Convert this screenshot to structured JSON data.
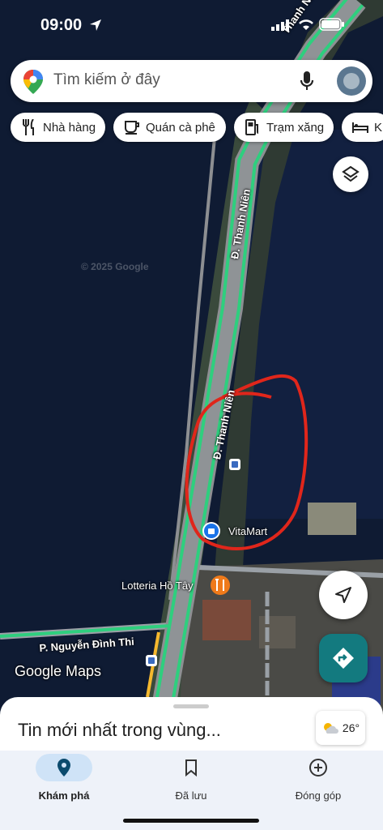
{
  "status_bar": {
    "time": "09:00"
  },
  "search": {
    "placeholder": "Tìm kiếm ở đây"
  },
  "chips": [
    {
      "label": "Nhà hàng",
      "icon": "fork-knife-icon"
    },
    {
      "label": "Quán cà phê",
      "icon": "coffee-cup-icon"
    },
    {
      "label": "Trạm xăng",
      "icon": "gas-pump-icon"
    },
    {
      "label": "Kh",
      "icon": "bed-icon"
    }
  ],
  "map": {
    "street_top": "Thanh Niên",
    "street_mid": "Đ. Thanh Niên",
    "street_low": "Đ. Thanh Niên",
    "street_bottom": "P. Nguyễn Đình Thi",
    "poi_vitamart": "VitaMart",
    "poi_lotteria": "Lotteria Hồ Tây",
    "watermark": "© 2025 Google",
    "brand": "Google Maps"
  },
  "sheet": {
    "title": "Tin mới nhất trong vùng..."
  },
  "weather": {
    "temp": "26°"
  },
  "nav": [
    {
      "label": "Khám phá",
      "icon": "explore-pin-icon",
      "active": true
    },
    {
      "label": "Đã lưu",
      "icon": "bookmark-icon",
      "active": false
    },
    {
      "label": "Đóng góp",
      "icon": "add-circle-icon",
      "active": false
    }
  ],
  "colors": {
    "accent": "#0b57d0",
    "route_green": "#2ecf7e",
    "directions": "#137a7f",
    "annotation": "#e0261b"
  }
}
